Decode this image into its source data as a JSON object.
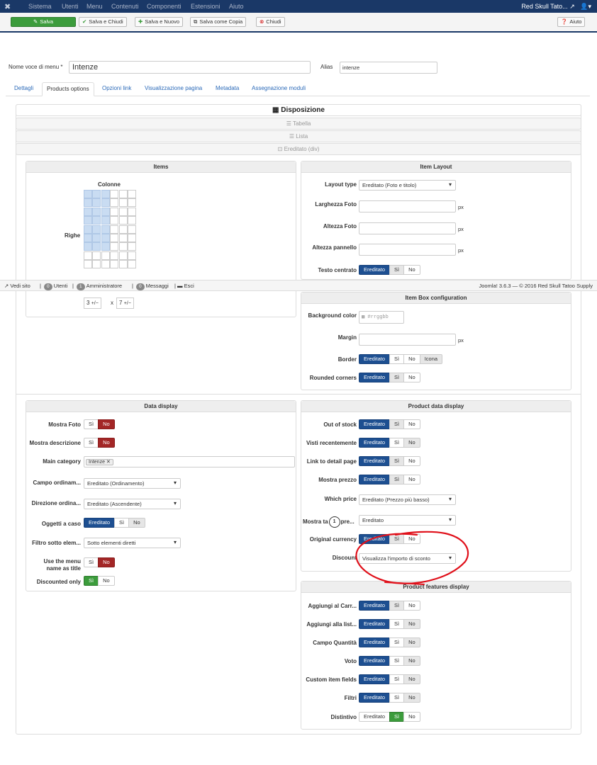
{
  "topnav": {
    "items": [
      "Sistema",
      "Utenti",
      "Menu",
      "Contenuti",
      "Componenti",
      "Estensioni",
      "Aiuto"
    ],
    "site": "Red Skull Tato...",
    "user_icon": "user-icon"
  },
  "toolbar": {
    "save": "Salva",
    "save_close": "Salva e Chiudi",
    "save_new": "Salva e Nuovo",
    "save_copy": "Salva come Copia",
    "close": "Chiudi",
    "help": "Aiuto"
  },
  "form": {
    "title_label": "Nome voce di menu *",
    "title_value": "Intenze",
    "alias_label": "Alias",
    "alias_value": "intenze"
  },
  "tabs": [
    "Dettagli",
    "Products options",
    "Opzioni link",
    "Visualizzazione pagina",
    "Metadata",
    "Assegnazione moduli"
  ],
  "layout": {
    "header": "Disposizione",
    "tabella": "Tabella",
    "lista": "Lista",
    "ereditato": "Ereditato (div)"
  },
  "items_panel": {
    "title": "Items",
    "colonne": "Colonne",
    "righe": "Righe",
    "cols": "3",
    "rows": "7",
    "sel_cols": 3,
    "sel_rows": 7
  },
  "item_layout": {
    "title": "Item Layout",
    "layout_type": "Layout type",
    "layout_value": "Ereditato (Foto e titolo)",
    "larghezza": "Larghezza Foto",
    "altezza": "Altezza Foto",
    "altezza_pannello": "Altezza pannello",
    "testo": "Testo centrato",
    "px": "px"
  },
  "footer": {
    "vedi": "Vedi sito",
    "utenti_n": "0",
    "utenti": "Utenti",
    "admin_n": "1",
    "admin": "Amministratore",
    "msg_n": "0",
    "msg": "Messaggi",
    "esci": "Esci",
    "version": "Joomla! 3.6.3 — © 2016 Red Skull Tatoo Supply"
  },
  "box_config": {
    "title": "Item Box configuration",
    "bg": "Background color",
    "bg_placeholder": "#rrggbb",
    "margin": "Margin",
    "border": "Border",
    "rounded": "Rounded corners",
    "icona": "Icona"
  },
  "opts": {
    "ereditato": "Ereditato",
    "si": "Sì",
    "no": "No"
  },
  "data_display": {
    "title": "Data display",
    "mostra_foto": "Mostra Foto",
    "mostra_desc": "Mostra descrizione",
    "main_cat": "Main category",
    "main_cat_tag": "Intenze",
    "campo": "Campo ordinam...",
    "campo_val": "Ereditato (Ordinamento)",
    "direzione": "Direzione ordina...",
    "direzione_val": "Ereditato (Ascendente)",
    "oggetti": "Oggetti a caso",
    "filtro": "Filtro sotto elem...",
    "filtro_val": "Sotto elementi diretti",
    "use_menu": "Use the menu name as title",
    "discounted": "Discounted only"
  },
  "product_data": {
    "title": "Product data display",
    "out_stock": "Out of stock",
    "visti": "Visti recentemente",
    "link": "Link to detail page",
    "mostra_prezzo": "Mostra prezzo",
    "which": "Which price",
    "which_val": "Ereditato (Prezzo più basso)",
    "mostra_ta": "Mostra ta",
    "mostra_ta2": "pre...",
    "mostra_ta_val": "Ereditato",
    "orig": "Original currency",
    "discount": "Discount",
    "discount_val": "Visualizza l'importo di sconto",
    "callout": "1"
  },
  "features": {
    "title": "Product features display",
    "carr": "Aggiungi al Carr...",
    "list": "Aggiungi alla list...",
    "qta": "Campo Quantità",
    "voto": "Voto",
    "custom": "Custom item fields",
    "filtri": "Filtri",
    "distintivo": "Distintivo"
  },
  "colors": {
    "nav": "#1a3867",
    "blue": "#1d4f91",
    "red": "#a32626",
    "green": "#3c9c3c",
    "annotation": "#e0101a"
  }
}
